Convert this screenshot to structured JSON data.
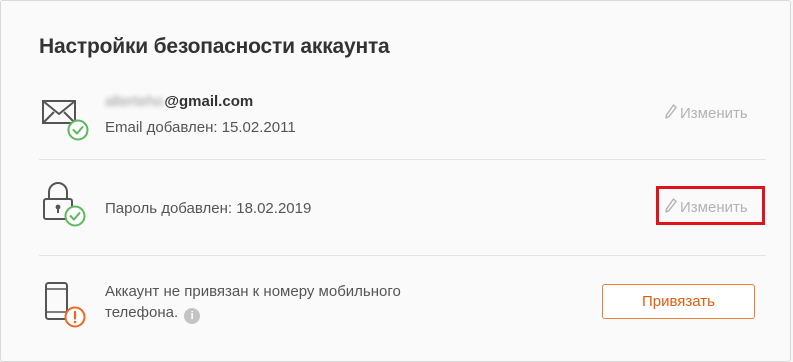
{
  "settings": {
    "title": "Настройки безопасности аккаунта",
    "email": {
      "username_blurred": "alterteho",
      "domain": "@gmail.com",
      "added_text": "Email добавлен: 15.02.2011",
      "edit_label": "Изменить",
      "status": "ok"
    },
    "password": {
      "added_text": "Пароль добавлен: 18.02.2019",
      "edit_label": "Изменить",
      "status": "ok"
    },
    "phone": {
      "text_line1": "Аккаунт не привязан к номеру мобильного",
      "text_line2": "телефона.",
      "info_icon": "i",
      "bind_label": "Привязать",
      "status": "warning"
    }
  },
  "colors": {
    "accent": "#ee8033",
    "ok": "#5cb85c",
    "warning": "#f26522",
    "highlight": "#e0121b"
  }
}
